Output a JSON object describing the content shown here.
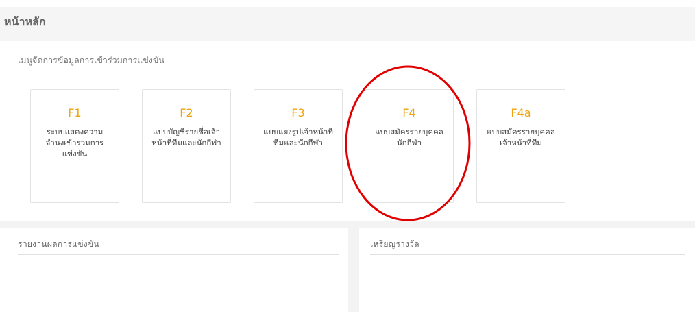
{
  "header": {
    "title": "หน้าหลัก"
  },
  "menu_panel": {
    "heading": "เมนูจัดการข้อมูลการเข้าร่วมการแข่งขัน",
    "cards": [
      {
        "code": "F1",
        "label": "ระบบแสดงความจำนงเข้าร่วมการแข่งขัน"
      },
      {
        "code": "F2",
        "label": "แบบบัญชีรายชื่อเจ้าหน้าที่ทีมและนักกีฬา"
      },
      {
        "code": "F3",
        "label": "แบบแผงรูปเจ้าหน้าที่ทีมและนักกีฬา"
      },
      {
        "code": "F4",
        "label": "แบบสมัครรายบุคคลนักกีฬา"
      },
      {
        "code": "F4a",
        "label": "แบบสมัครรายบุคคลเจ้าหน้าที่ทีม"
      }
    ]
  },
  "results_panel": {
    "heading": "รายงานผลการแข่งขัน"
  },
  "medals_panel": {
    "heading": "เหรียญรางวัล"
  },
  "colors": {
    "card_code": "#f0a30a",
    "highlight": "#e00000",
    "header_bg": "#f5f5f5"
  }
}
